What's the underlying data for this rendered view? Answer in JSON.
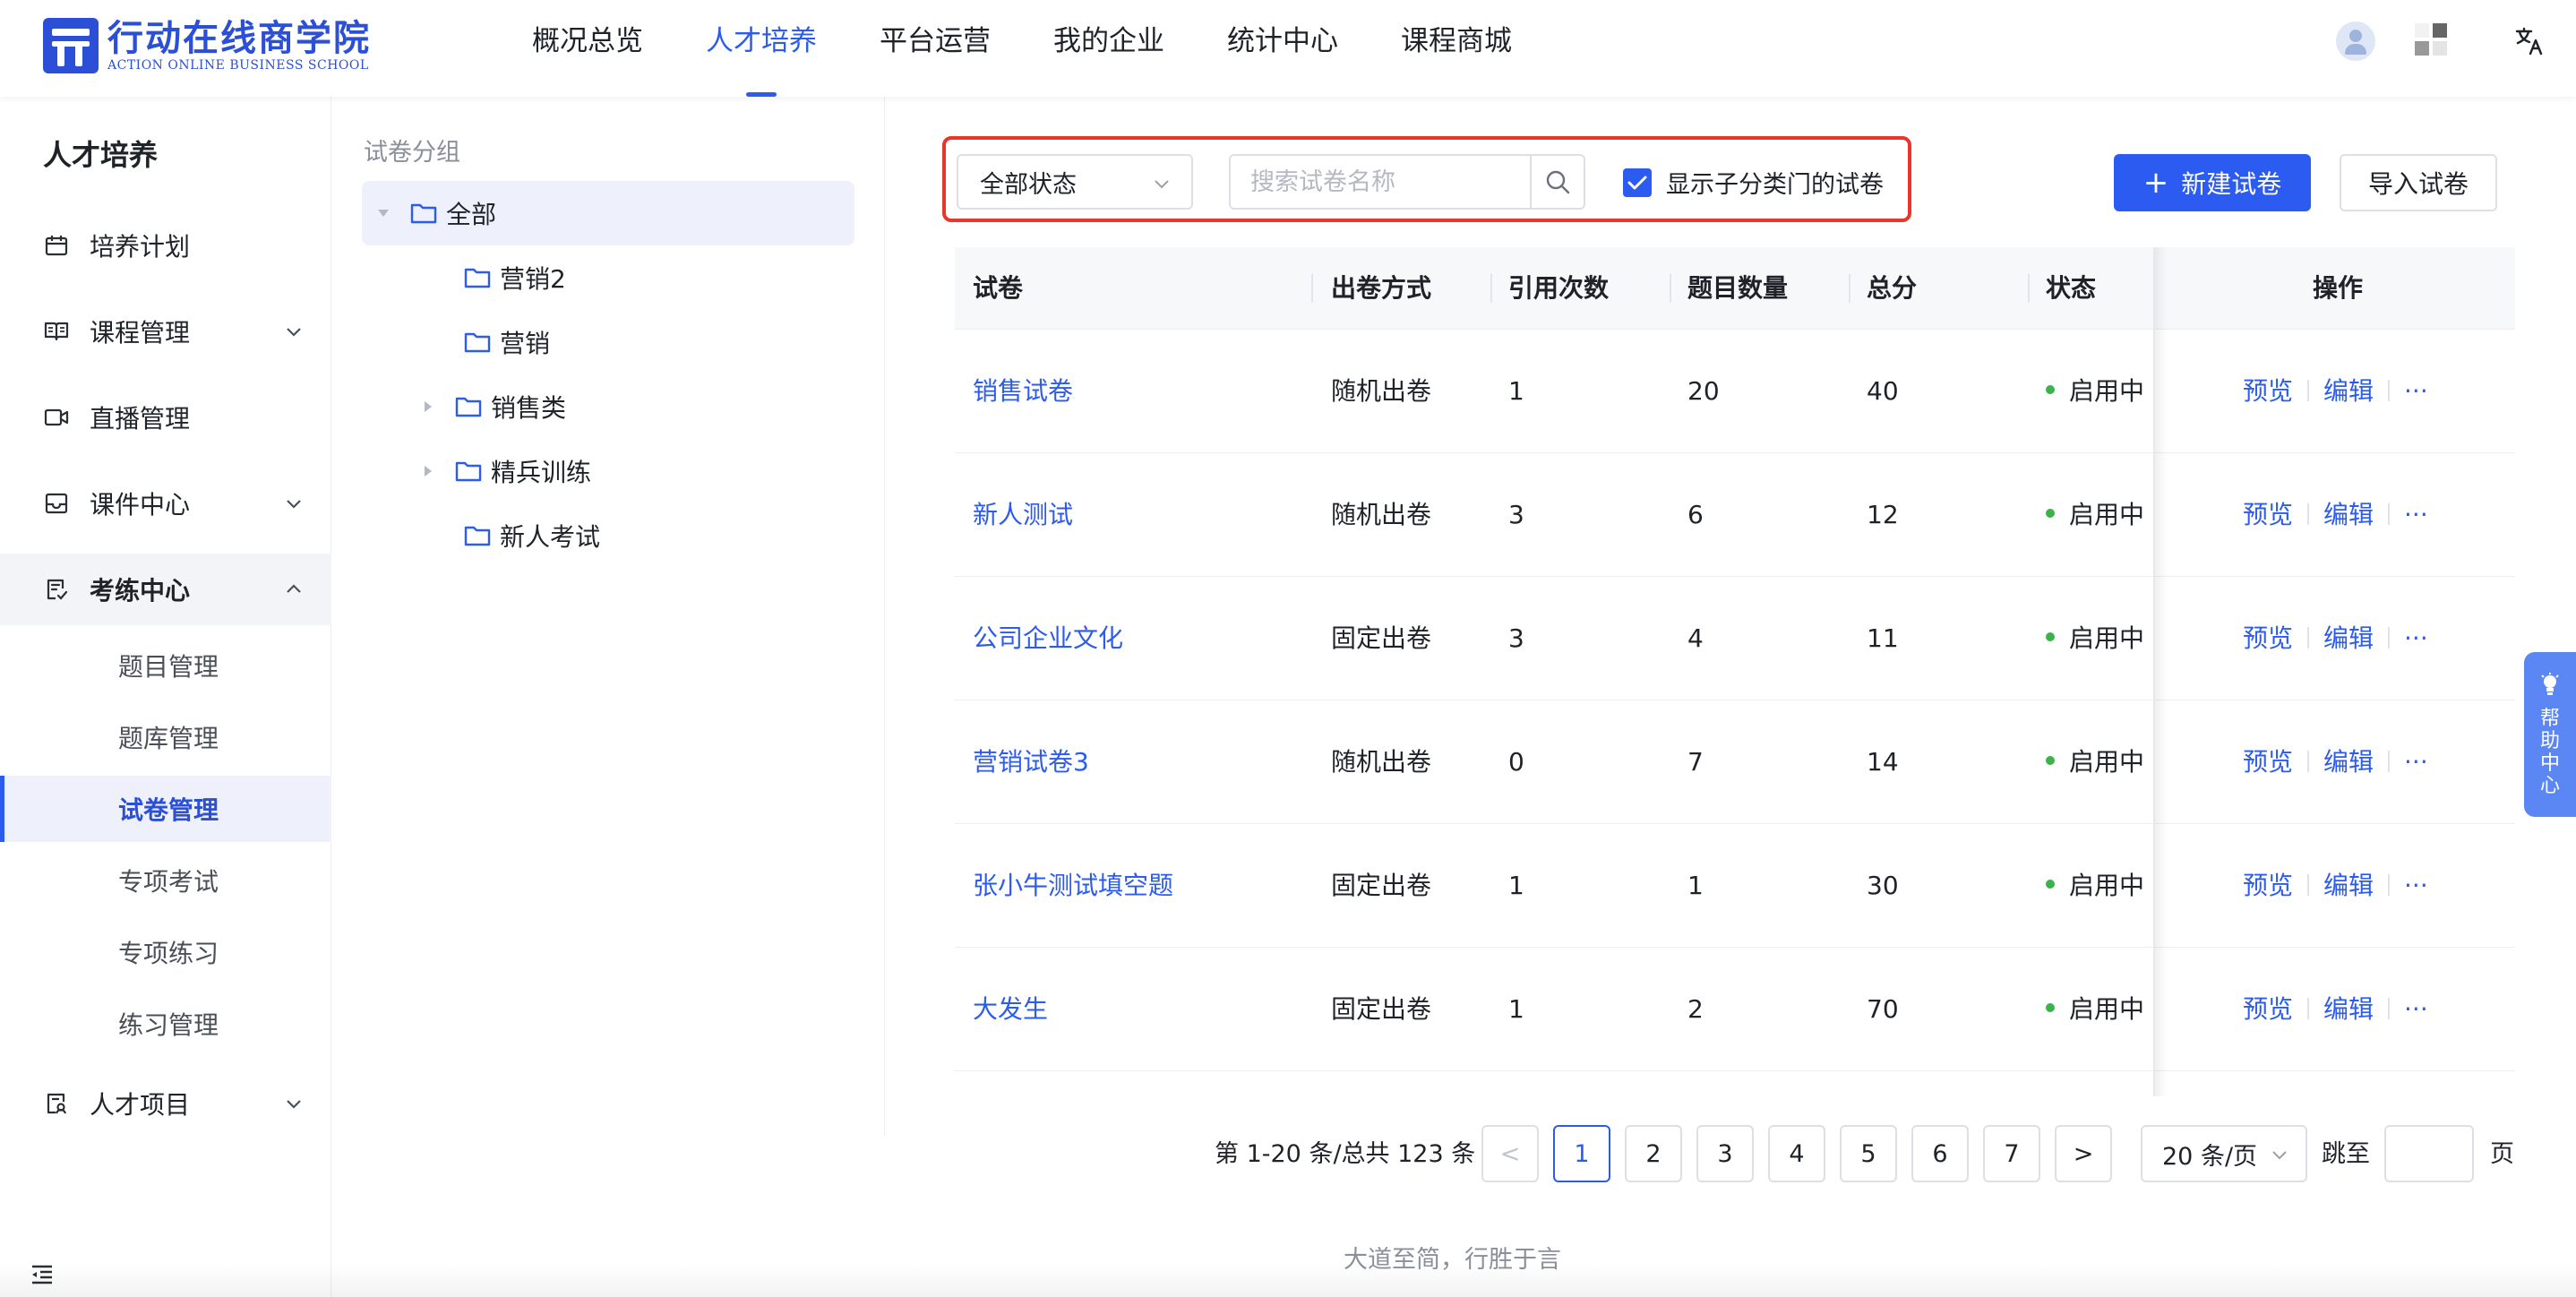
{
  "brand": {
    "name_cn": "行动在线商学院",
    "name_en": "ACTION ONLINE BUSINESS SCHOOL",
    "color": "#2b4fd6"
  },
  "nav": {
    "items": [
      {
        "label": "概况总览"
      },
      {
        "label": "人才培养",
        "active": true
      },
      {
        "label": "平台运营"
      },
      {
        "label": "我的企业"
      },
      {
        "label": "统计中心"
      },
      {
        "label": "课程商城"
      }
    ]
  },
  "header_icons": [
    "avatar-icon",
    "qrcode-icon",
    "translate-icon"
  ],
  "header": {
    "lang_glyph": "文A"
  },
  "sidebar": {
    "title": "人才培养",
    "items": [
      {
        "label": "培养计划",
        "icon": "calendar-icon"
      },
      {
        "label": "课程管理",
        "icon": "book-icon"
      },
      {
        "label": "直播管理",
        "icon": "video-icon"
      },
      {
        "label": "课件中心",
        "icon": "inbox-icon"
      },
      {
        "label": "考练中心",
        "icon": "exam-icon",
        "expanded": true
      },
      {
        "label": "人才项目",
        "icon": "project-icon"
      }
    ],
    "sub_items": [
      {
        "label": "题目管理"
      },
      {
        "label": "题库管理"
      },
      {
        "label": "试卷管理",
        "active": true
      },
      {
        "label": "专项考试"
      },
      {
        "label": "专项练习"
      },
      {
        "label": "练习管理"
      }
    ]
  },
  "tree": {
    "title": "试卷分组",
    "nodes": [
      {
        "label": "全部",
        "selected": true
      },
      {
        "label": "营销2"
      },
      {
        "label": "营销"
      },
      {
        "label": "销售类"
      },
      {
        "label": "精兵训练"
      },
      {
        "label": "新人考试"
      }
    ]
  },
  "filters": {
    "status_select": "全部状态",
    "search_placeholder": "搜索试卷名称",
    "show_children_label": "显示子分类门的试卷",
    "show_children_checked": true
  },
  "actions": {
    "new_label": "新建试卷",
    "import_label": "导入试卷"
  },
  "table": {
    "columns": [
      "试卷",
      "出卷方式",
      "引用次数",
      "题目数量",
      "总分",
      "状态",
      "操作"
    ],
    "rows": [
      {
        "name": "销售试卷",
        "mode": "随机出卷",
        "refs": "1",
        "count": "20",
        "score": "40",
        "status": "启用中"
      },
      {
        "name": "新人测试",
        "mode": "随机出卷",
        "refs": "3",
        "count": "6",
        "score": "12",
        "status": "启用中"
      },
      {
        "name": "公司企业文化",
        "mode": "固定出卷",
        "refs": "3",
        "count": "4",
        "score": "11",
        "status": "启用中"
      },
      {
        "name": "营销试卷3",
        "mode": "随机出卷",
        "refs": "0",
        "count": "7",
        "score": "14",
        "status": "启用中"
      },
      {
        "name": "张小牛测试填空题",
        "mode": "固定出卷",
        "refs": "1",
        "count": "1",
        "score": "30",
        "status": "启用中"
      },
      {
        "name": "大发生",
        "mode": "固定出卷",
        "refs": "1",
        "count": "2",
        "score": "70",
        "status": "启用中"
      }
    ],
    "row_ops": {
      "preview": "预览",
      "edit": "编辑",
      "more": "···"
    }
  },
  "pagination": {
    "total_text": "第 1-20 条/总共 123 条",
    "prev": "<",
    "next": ">",
    "pages": [
      "1",
      "2",
      "3",
      "4",
      "5",
      "6",
      "7"
    ],
    "current": "1",
    "page_size": "20 条/页",
    "jump_label": "跳至",
    "page_label": "页"
  },
  "footer": "大道至简，行胜于言",
  "help": {
    "label": "帮助中心"
  },
  "colors": {
    "primary": "#2b5bf0",
    "highlight_border": "#e8362c",
    "status_green": "#3bb34a"
  }
}
